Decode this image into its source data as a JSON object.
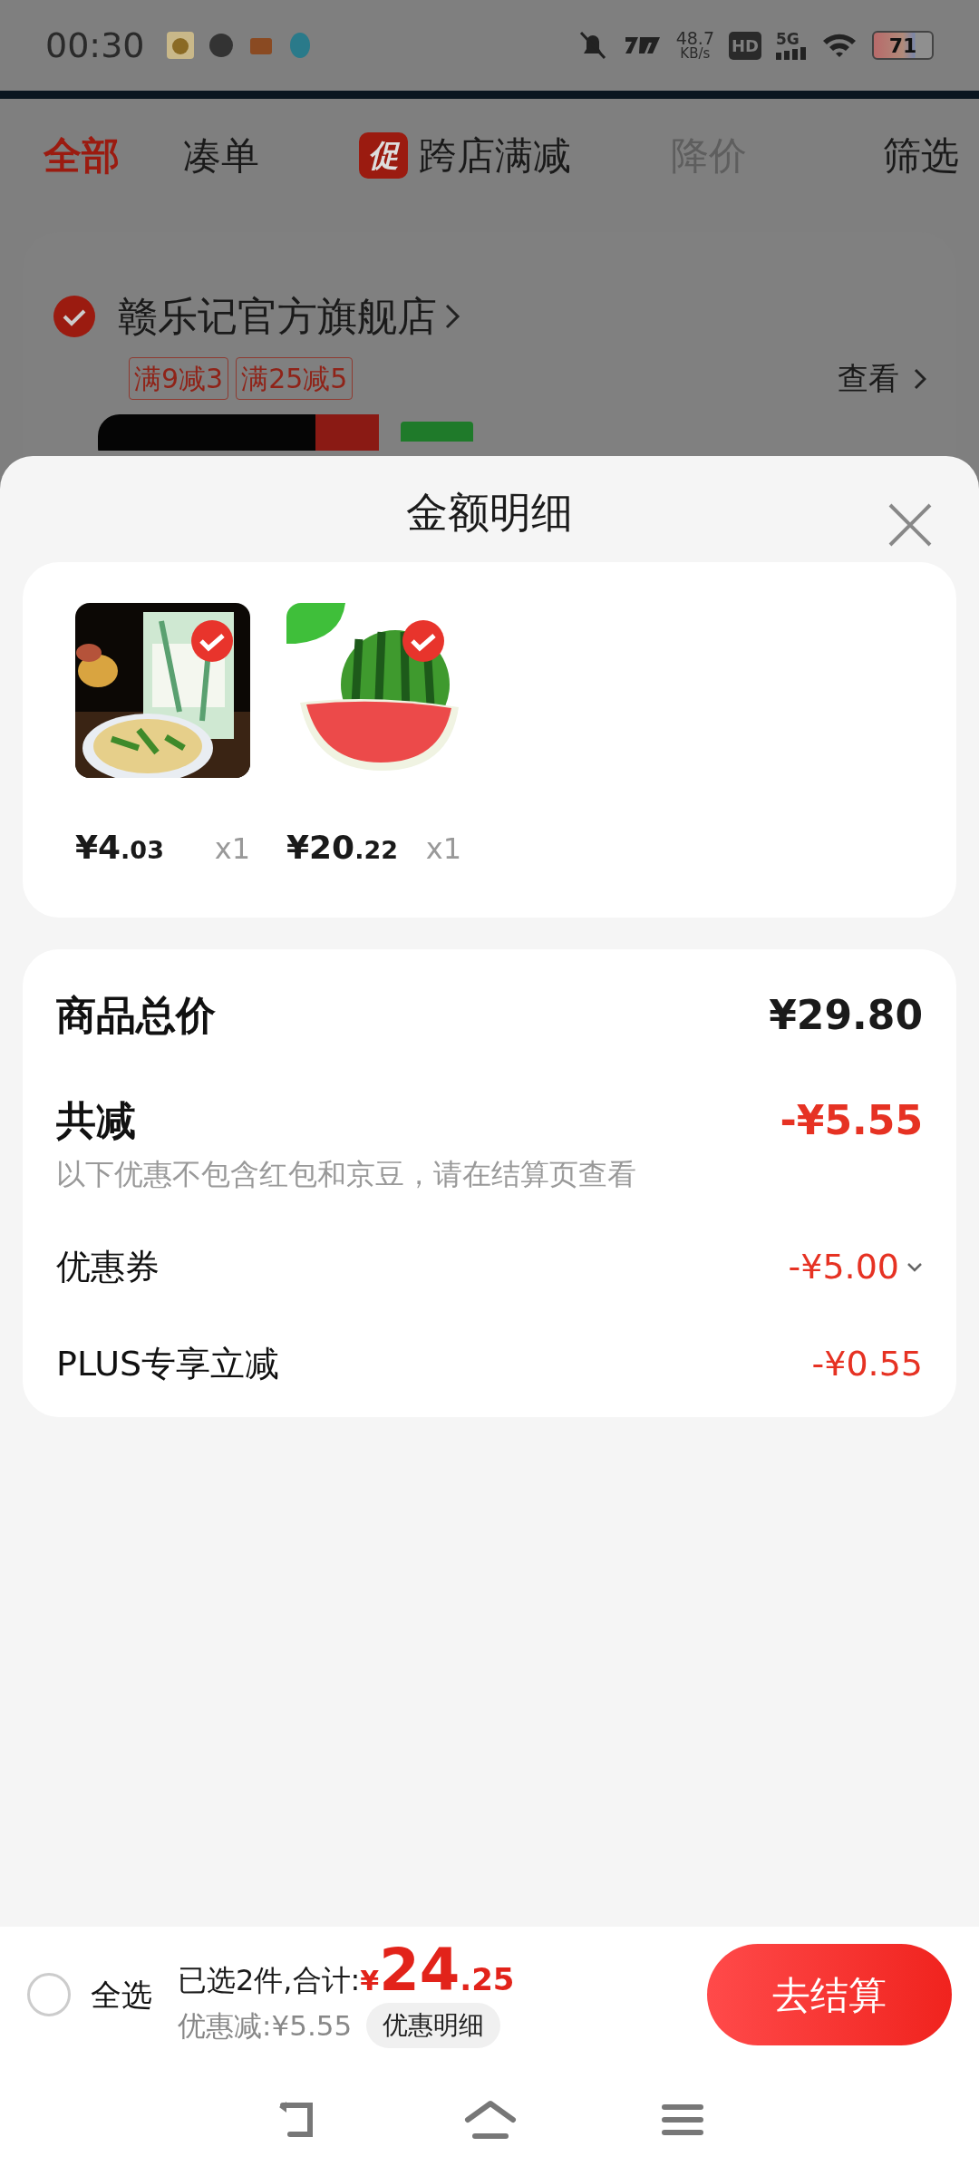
{
  "status_bar": {
    "time": "00:30",
    "net_speed": "48.7",
    "net_unit": "KB/s",
    "hd": "HD",
    "network": "5G",
    "battery": "71"
  },
  "tabs": [
    {
      "label": "全部",
      "selected": true,
      "disabled": false
    },
    {
      "label": "凑单",
      "selected": false,
      "disabled": false
    },
    {
      "label": "跨店满减",
      "selected": false,
      "disabled": false,
      "badge": "促"
    },
    {
      "label": "降价",
      "selected": false,
      "disabled": true
    },
    {
      "label": "筛选",
      "selected": false,
      "disabled": false
    }
  ],
  "store": {
    "name": "赣乐记官方旗舰店",
    "checked": true,
    "promos": [
      "满9减3",
      "满25减5"
    ],
    "view_link": "查看"
  },
  "sheet": {
    "title": "金额明细",
    "items": [
      {
        "kind": "noodles",
        "checked": true,
        "price_main": "¥4",
        "price_decimal": ".03",
        "qty": "x1"
      },
      {
        "kind": "watermelon",
        "checked": true,
        "price_main": "¥20",
        "price_decimal": ".22",
        "qty": "x1"
      }
    ],
    "summary": [
      {
        "kind": "total",
        "label": "商品总价",
        "value": "¥29.80"
      },
      {
        "kind": "discount",
        "label": "共减",
        "value": "-¥5.55",
        "note": "以下优惠不包含红包和京豆，请在结算页查看"
      },
      {
        "kind": "detail",
        "label": "优惠券",
        "value": "-¥5.00",
        "expandable": true
      },
      {
        "kind": "detail",
        "label": "PLUS专享立减",
        "value": "-¥0.55",
        "expandable": false
      }
    ]
  },
  "bottom_bar": {
    "select_all": {
      "label": "全选",
      "checked": false
    },
    "selected_text": "已选2件,合计:",
    "currency": "¥",
    "total_main": "24",
    "total_decimal": ".25",
    "savings": "优惠减:¥5.55",
    "details_button": "优惠明细",
    "checkout": "去结算"
  }
}
